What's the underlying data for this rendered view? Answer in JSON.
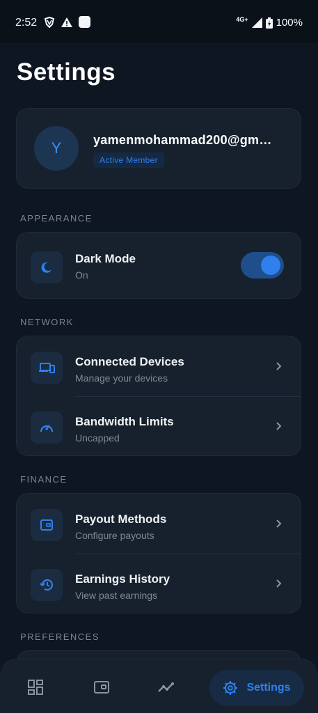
{
  "status_bar": {
    "time": "2:52",
    "network": "4G+",
    "battery": "100%"
  },
  "title": "Settings",
  "profile": {
    "avatar_initial": "Y",
    "email": "yamenmohammad200@gm…",
    "badge": "Active Member"
  },
  "sections": {
    "appearance": "APPEARANCE",
    "network": "NETWORK",
    "finance": "FINANCE",
    "preferences": "PREFERENCES"
  },
  "dark_mode": {
    "title": "Dark Mode",
    "subtitle": "On",
    "enabled": true
  },
  "network_items": [
    {
      "title": "Connected Devices",
      "subtitle": "Manage your devices",
      "icon": "devices-icon"
    },
    {
      "title": "Bandwidth Limits",
      "subtitle": "Uncapped",
      "icon": "speedometer-icon"
    }
  ],
  "finance_items": [
    {
      "title": "Payout Methods",
      "subtitle": "Configure payouts",
      "icon": "wallet-icon"
    },
    {
      "title": "Earnings History",
      "subtitle": "View past earnings",
      "icon": "history-icon"
    }
  ],
  "nav": {
    "active_label": "Settings"
  },
  "colors": {
    "accent": "#2f80ed",
    "background": "#0e1621",
    "card": "#17212d"
  }
}
